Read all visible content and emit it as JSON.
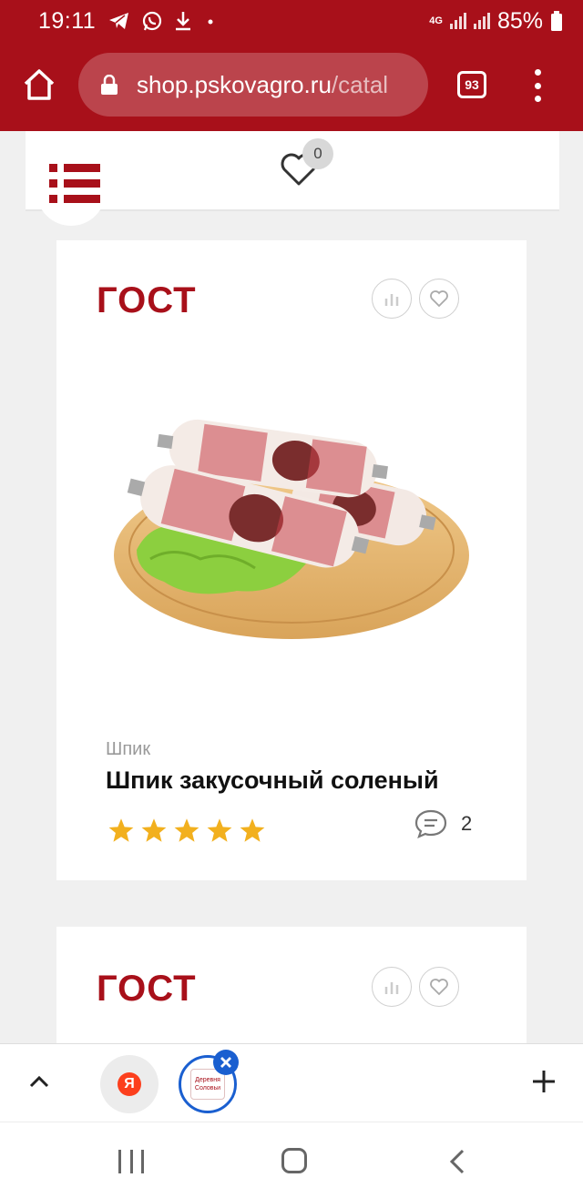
{
  "status_bar": {
    "time": "19:11",
    "network": "4G",
    "battery": "85%",
    "icons": [
      "telegram-icon",
      "whatsapp-icon",
      "download-icon",
      "dot-icon",
      "signal-icon",
      "battery-icon"
    ]
  },
  "browser": {
    "url_domain": "shop.pskovagro.ru",
    "url_path": "/catal",
    "tabs_count": "93"
  },
  "header": {
    "favorites_count": "0"
  },
  "products": [
    {
      "badge": "ГОСТ",
      "category": "Шпик",
      "title": "Шпик закусочный соленый",
      "rating": 5,
      "comments_count": "2"
    },
    {
      "badge": "ГОСТ"
    }
  ],
  "bottom_tabs": {
    "yandex_letter": "Я",
    "site_logo_text": [
      "Деревня",
      "Соловьи"
    ]
  },
  "colors": {
    "brand_red": "#a8101a",
    "star": "#f2b01e",
    "tab_blue": "#1a5fd0"
  }
}
